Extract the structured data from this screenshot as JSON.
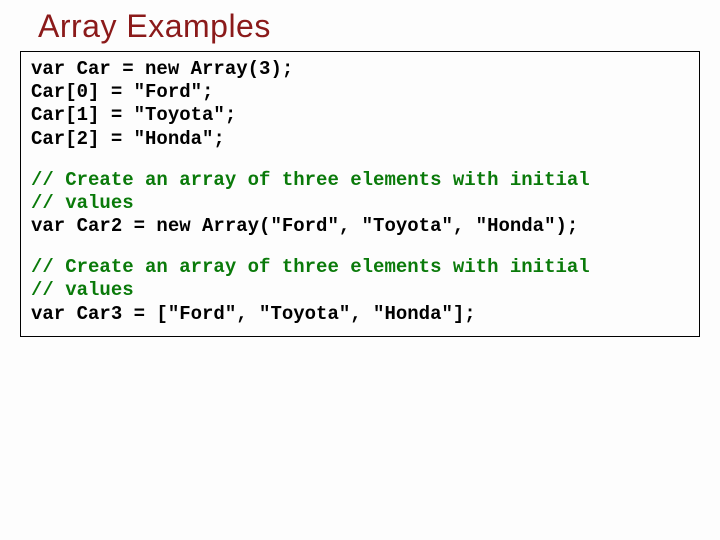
{
  "title": "Array Examples",
  "code": {
    "block1": {
      "l1": "var Car = new Array(3);",
      "l2": "Car[0] = \"Ford\";",
      "l3": "Car[1] = \"Toyota\";",
      "l4": "Car[2] = \"Honda\";"
    },
    "block2": {
      "c1": "// Create an array of three elements with initial",
      "c2": "// values",
      "l1": "var Car2 = new Array(\"Ford\", \"Toyota\", \"Honda\");"
    },
    "block3": {
      "c1": "// Create an array of three elements with initial",
      "c2": "// values",
      "l1": "var Car3 = [\"Ford\", \"Toyota\", \"Honda\"];"
    }
  }
}
